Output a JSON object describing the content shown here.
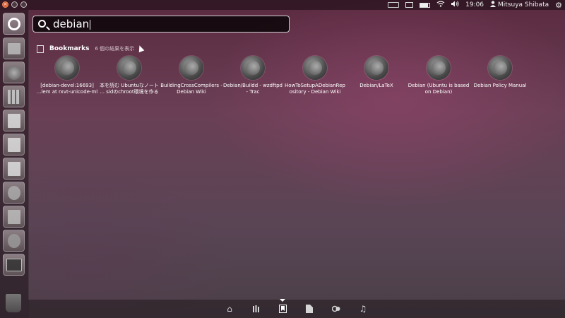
{
  "panel": {
    "time": "19:06",
    "user": "Mitsuya Shibata"
  },
  "search": {
    "query": "debian"
  },
  "category": {
    "title": "Bookmarks",
    "count_text": "6 個の結果を表示"
  },
  "results": [
    {
      "line1": "[debian-devel:16693]",
      "line2": "...lem at rxvt-unicode-ml"
    },
    {
      "line1": "本を読む Ubuntuなノート",
      "line2": "... sidのchroot環境を作る"
    },
    {
      "line1": "BuildingCrossCompilers -",
      "line2": "Debian Wiki"
    },
    {
      "line1": "Debian/Buildd - wzdftpd",
      "line2": "- Trac"
    },
    {
      "line1": "HowToSetupADebianRep",
      "line2": "ository - Debian Wiki"
    },
    {
      "line1": "Debian/LaTeX",
      "line2": ""
    },
    {
      "line1": "Debian (Ubuntu is based",
      "line2": "on Debian)"
    },
    {
      "line1": "Debian Policy Manual",
      "line2": ""
    }
  ],
  "launcher": {
    "items": [
      "dash-icon",
      "home-folder-icon",
      "firefox-icon",
      "workspace-switcher-icon",
      "writer-icon",
      "calc-icon",
      "impress-icon",
      "system-settings-icon",
      "software-center-icon",
      "ubuntu-one-icon",
      "terminal-icon",
      "trash-icon"
    ]
  },
  "lenses": [
    "home-lens-icon",
    "applications-lens-icon",
    "bookmarks-lens-icon",
    "files-lens-icon",
    "video-lens-icon",
    "music-lens-icon"
  ],
  "colors": {
    "accent": "#e05a2b",
    "background": "#5a2a40"
  }
}
